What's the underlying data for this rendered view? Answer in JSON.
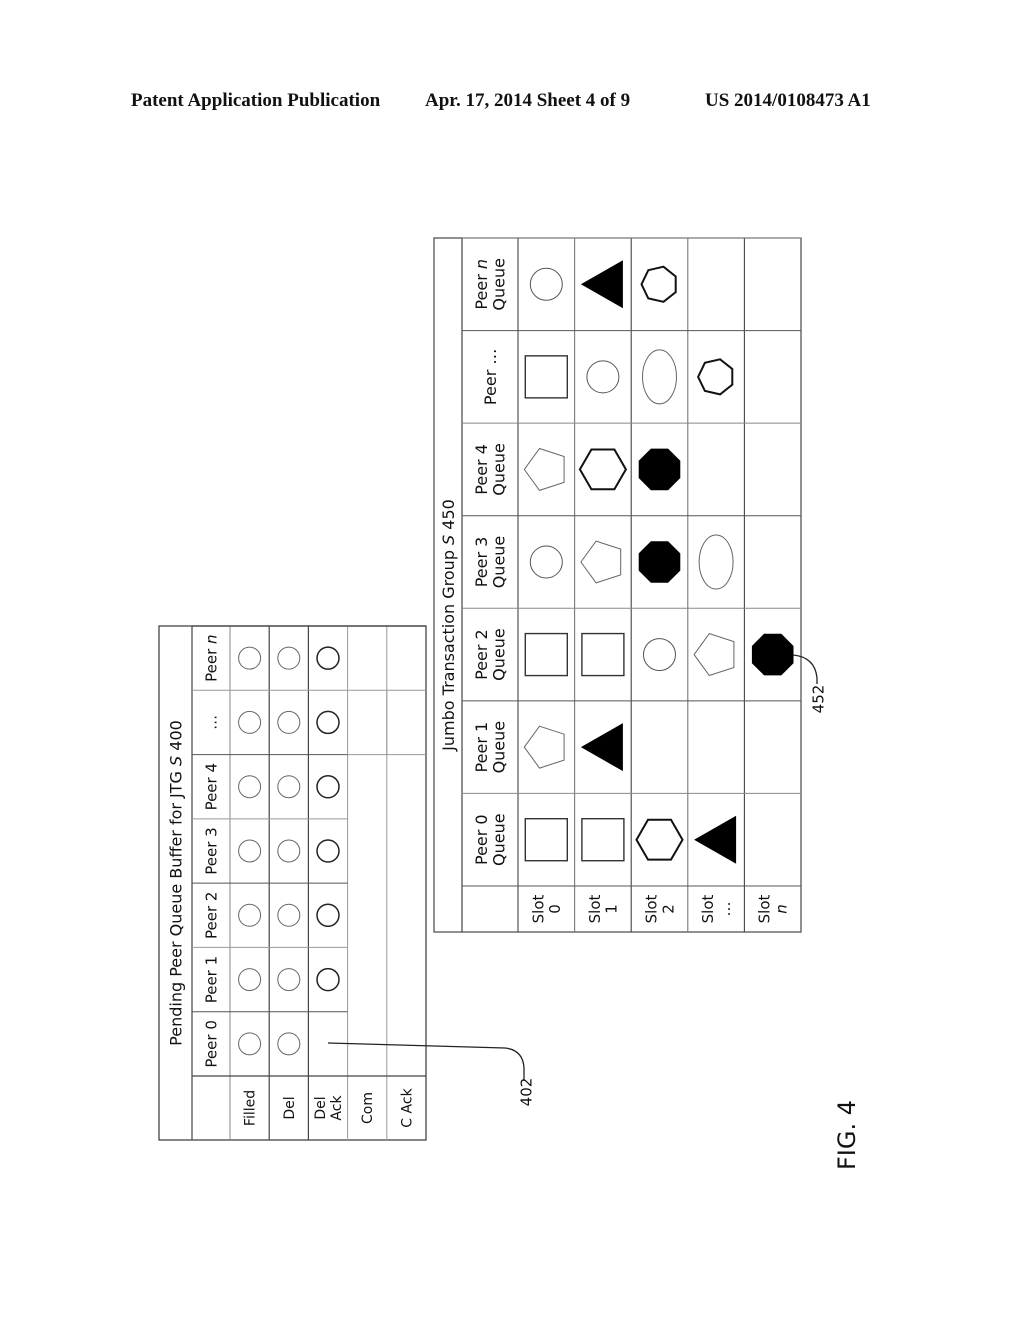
{
  "header": {
    "left": "Patent Application Publication",
    "middle": "Apr. 17, 2014  Sheet 4 of 9",
    "right": "US 2014/0108473 A1"
  },
  "figure_label": "FIG. 4",
  "pending_buffer": {
    "title": "Pending Peer Queue Buffer for JTG ",
    "title_id": "S",
    "title_num": "400",
    "columns": [
      "Peer 0",
      "Peer 1",
      "Peer 2",
      "Peer 3",
      "Peer 4",
      "…",
      "Peer n"
    ],
    "rows": [
      {
        "label": [
          "Filled"
        ],
        "marks": [
          true,
          true,
          true,
          true,
          true,
          true,
          true
        ]
      },
      {
        "label": [
          "Del"
        ],
        "marks": [
          true,
          true,
          true,
          true,
          true,
          true,
          true
        ]
      },
      {
        "label": [
          "Del",
          "Ack"
        ],
        "marks": [
          false,
          true,
          true,
          true,
          true,
          true,
          true
        ]
      },
      {
        "label": [
          "Com"
        ],
        "marks": [
          false,
          false,
          false,
          false,
          false,
          false,
          false
        ]
      },
      {
        "label": [
          "C Ack"
        ],
        "marks": [
          false,
          false,
          false,
          false,
          false,
          false,
          false
        ]
      }
    ],
    "callout": "402"
  },
  "jumbo_group": {
    "title": "Jumbo Transaction Group ",
    "title_id": "S",
    "title_num": "450",
    "columns": [
      [
        "Peer 0",
        "Queue"
      ],
      [
        "Peer 1",
        "Queue"
      ],
      [
        "Peer 2",
        "Queue"
      ],
      [
        "Peer 3",
        "Queue"
      ],
      [
        "Peer 4",
        "Queue"
      ],
      [
        "Peer …"
      ],
      [
        "Peer n",
        "Queue"
      ]
    ],
    "rows": [
      {
        "label": [
          "Slot",
          "0"
        ],
        "cells": [
          "square",
          "pentagon",
          "square",
          "circle",
          "pentagon",
          "square",
          "circle"
        ]
      },
      {
        "label": [
          "Slot",
          "1"
        ],
        "cells": [
          "square",
          "filled-triangle",
          "square",
          "pentagon",
          "hexagon",
          "circle",
          "filled-triangle"
        ]
      },
      {
        "label": [
          "Slot",
          "2"
        ],
        "cells": [
          "hexagon",
          "",
          "circle",
          "filled-octagon",
          "filled-octagon",
          "ellipse",
          "heptagon"
        ]
      },
      {
        "label": [
          "Slot",
          "…"
        ],
        "cells": [
          "filled-triangle",
          "",
          "pentagon",
          "ellipse",
          "",
          "heptagon",
          ""
        ]
      },
      {
        "label": [
          "Slot",
          "n"
        ],
        "cells": [
          "",
          "",
          "filled-octagon",
          "",
          "",
          "",
          ""
        ]
      }
    ],
    "callout": "452"
  }
}
